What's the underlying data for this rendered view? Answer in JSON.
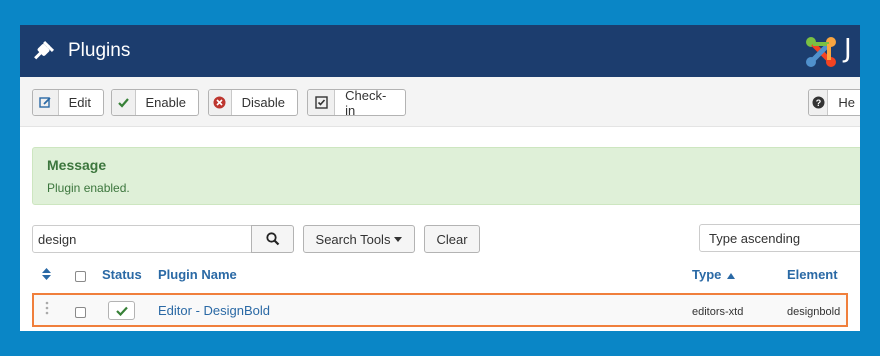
{
  "header": {
    "title": "Plugins",
    "logo_text": "J"
  },
  "toolbar": {
    "edit": "Edit",
    "enable": "Enable",
    "disable": "Disable",
    "checkin": "Check-in",
    "help": "He"
  },
  "message": {
    "heading": "Message",
    "text": "Plugin enabled."
  },
  "filters": {
    "search_value": "design",
    "search_tools": "Search Tools",
    "clear": "Clear",
    "ordering": "Type ascending"
  },
  "table": {
    "headers": {
      "status": "Status",
      "name": "Plugin Name",
      "type": "Type",
      "element": "Element"
    },
    "rows": [
      {
        "name": "Editor - DesignBold",
        "type": "editors-xtd",
        "element": "designbold",
        "enabled": true
      }
    ]
  },
  "colors": {
    "header_bg": "#1c3d6e",
    "highlight": "#f07f3c",
    "link": "#2a69a5",
    "success": "#3c763d"
  },
  "icons": [
    "plug-icon",
    "joomla-logo",
    "edit-icon",
    "check-icon",
    "disable-icon",
    "checkin-icon",
    "help-icon",
    "search-icon",
    "sort-icon",
    "drag-handle-icon"
  ]
}
